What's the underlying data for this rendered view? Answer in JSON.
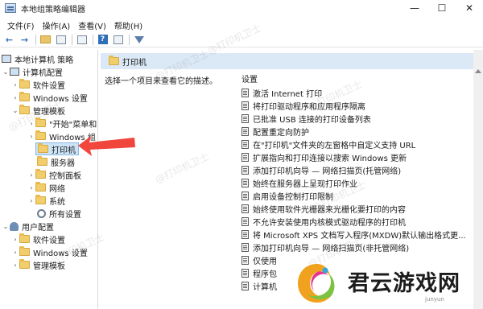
{
  "window": {
    "title": "本地组策略编辑器",
    "controls": {
      "minimize": "—",
      "maximize": "☐",
      "close": "✕"
    }
  },
  "menubar": [
    {
      "label": "文件(F)"
    },
    {
      "label": "操作(A)"
    },
    {
      "label": "查看(V)"
    },
    {
      "label": "帮助(H)"
    }
  ],
  "tree": {
    "root": "本地计算机 策略",
    "items": [
      {
        "label": "计算机配置"
      },
      {
        "label": "软件设置"
      },
      {
        "label": "Windows 设置"
      },
      {
        "label": "管理模板"
      },
      {
        "label": "\"开始\"菜单和"
      },
      {
        "label": "Windows 组"
      },
      {
        "label": "打印机"
      },
      {
        "label": "服务器"
      },
      {
        "label": "控制面板"
      },
      {
        "label": "网络"
      },
      {
        "label": "系统"
      },
      {
        "label": "所有设置"
      },
      {
        "label": "用户配置"
      },
      {
        "label": "软件设置"
      },
      {
        "label": "Windows 设置"
      },
      {
        "label": "管理模板"
      }
    ]
  },
  "right_pane": {
    "header_title": "打印机",
    "description": "选择一个项目来查看它的描述。",
    "settings_column": "设置",
    "settings": [
      "激活 Internet 打印",
      "将打印驱动程序和应用程序隔离",
      "已批准 USB 连接的打印设备列表",
      "配置重定向防护",
      "在\"打印机\"文件夹的左窗格中自定义支持 URL",
      "扩展指向和打印连接以搜索 Windows 更新",
      "添加打印机向导 — 网络扫描页(托管网络)",
      "始终在服务器上呈现打印作业",
      "启用设备控制打印限制",
      "始终使用软件光栅器来光栅化要打印的内容",
      "不允许安装使用内核模式驱动程序的打印机",
      "将 Microsoft XPS 文档写入程序(MXDW)默认输出格式更...",
      "添加打印机向导 — 网络扫描页(非托管网络)",
      "仅使用",
      "程序包",
      "计算机"
    ]
  },
  "watermark_text": "@打印机卫士",
  "brand": {
    "name": "君云游戏网",
    "url": "junyun"
  },
  "colors": {
    "header_bg": "#dbe8f5",
    "selection_bg": "#cde4f7",
    "arrow": "#f0463c"
  }
}
